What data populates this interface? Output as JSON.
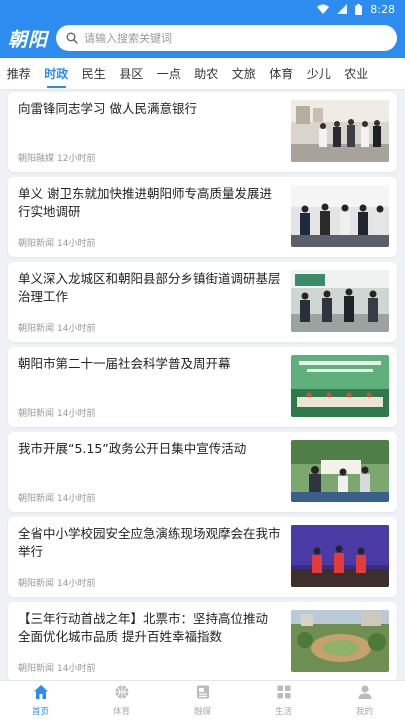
{
  "status_bar": {
    "time": "8:28"
  },
  "header": {
    "logo": "朝阳",
    "search_placeholder": "请输入搜索关键词"
  },
  "tabs": [
    {
      "label": "推荐",
      "active": false
    },
    {
      "label": "时政",
      "active": true
    },
    {
      "label": "民生",
      "active": false
    },
    {
      "label": "县区",
      "active": false
    },
    {
      "label": "一点",
      "active": false
    },
    {
      "label": "助农",
      "active": false
    },
    {
      "label": "文旅",
      "active": false
    },
    {
      "label": "体育",
      "active": false
    },
    {
      "label": "少儿",
      "active": false
    },
    {
      "label": "农业",
      "active": false
    }
  ],
  "news": [
    {
      "title": "向雷锋同志学习 做人民满意银行",
      "source": "朝阳融媒",
      "time": "12小时前",
      "thumb": "thumb-gallery"
    },
    {
      "title": "单义 谢卫东就加快推进朝阳师专高质量发展进行实地调研",
      "source": "朝阳新闻",
      "time": "14小时前",
      "thumb": "thumb-officials"
    },
    {
      "title": "单义深入龙城区和朝阳县部分乡镇街道调研基层治理工作",
      "source": "朝阳新闻",
      "time": "14小时前",
      "thumb": "thumb-meeting"
    },
    {
      "title": "朝阳市第二十一届社会科学普及周开幕",
      "source": "朝阳新闻",
      "time": "14小时前",
      "thumb": "thumb-stage"
    },
    {
      "title": "我市开展“5.15”政务公开日集中宣传活动",
      "source": "朝阳新闻",
      "time": "14小时前",
      "thumb": "thumb-outdoor"
    },
    {
      "title": "全省中小学校园安全应急演练现场观摩会在我市举行",
      "source": "朝阳新闻",
      "time": "14小时前",
      "thumb": "thumb-performance"
    },
    {
      "title": "【三年行动首战之年】北票市：坚持高位推动 全面优化城市品质 提升百姓幸福指数",
      "source": "朝阳新闻",
      "time": "14小时前",
      "thumb": "thumb-park"
    }
  ],
  "bottom_nav": [
    {
      "label": "首页",
      "icon": "home-icon",
      "active": true
    },
    {
      "label": "体育",
      "icon": "basketball-icon",
      "active": false
    },
    {
      "label": "融媒",
      "icon": "media-icon",
      "active": false
    },
    {
      "label": "生活",
      "icon": "grid-icon",
      "active": false
    },
    {
      "label": "我的",
      "icon": "profile-icon",
      "active": false
    }
  ],
  "colors": {
    "primary": "#2d8cf0",
    "inactive": "#aaaaaa",
    "text": "#222222",
    "meta": "#999999"
  }
}
